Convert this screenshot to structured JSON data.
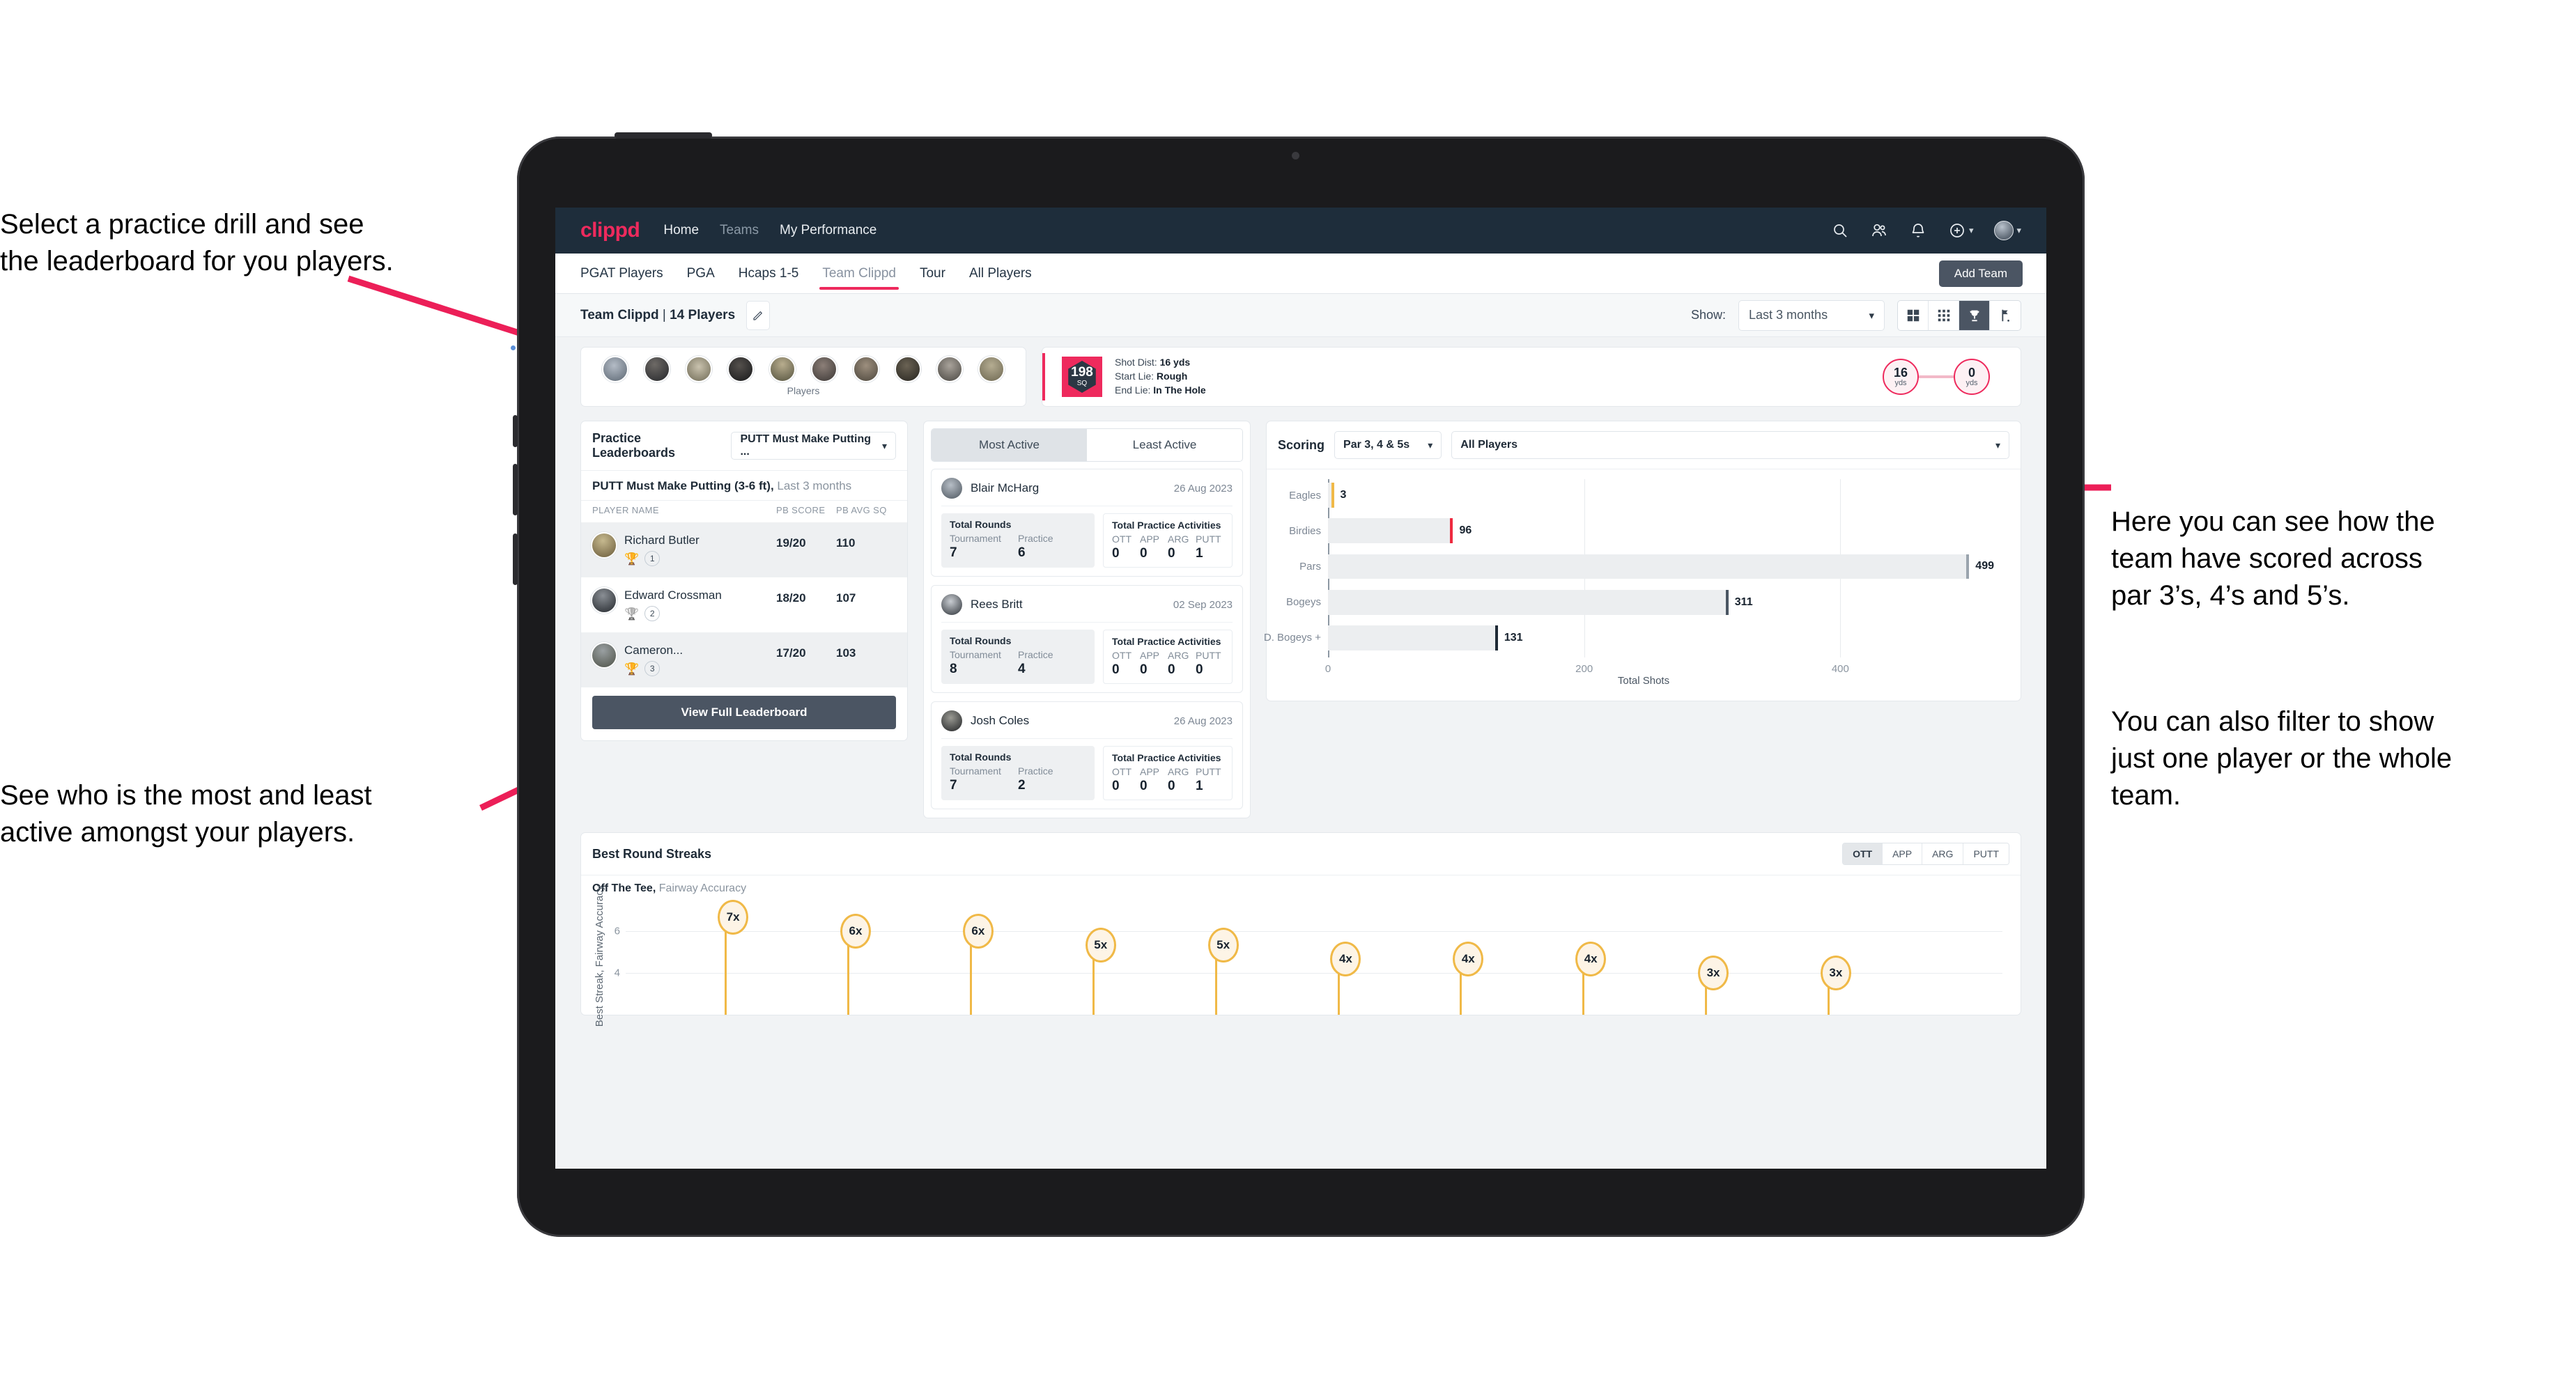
{
  "annotations": [
    {
      "id": "a1",
      "text": "Select a practice drill and see\nthe leaderboard for you players."
    },
    {
      "id": "a2",
      "text": "See who is the most and least\nactive amongst your players."
    },
    {
      "id": "a3",
      "text": "Here you can see how the\nteam have scored across\npar 3’s, 4’s and 5’s."
    },
    {
      "id": "a4",
      "text": "You can also filter to show\njust one player or the whole\nteam."
    }
  ],
  "topnav": {
    "logo": "clippd",
    "links": [
      {
        "label": "Home",
        "active": true
      },
      {
        "label": "Teams",
        "active": false
      },
      {
        "label": "My Performance",
        "active": true
      }
    ],
    "icons": [
      "search-icon",
      "people-icon",
      "bell-icon",
      "plus-circle-icon",
      "avatar"
    ]
  },
  "tabs": [
    {
      "label": "PGAT Players",
      "active": false
    },
    {
      "label": "PGA",
      "active": false
    },
    {
      "label": "Hcaps 1-5",
      "active": false
    },
    {
      "label": "Team Clippd",
      "active": true
    },
    {
      "label": "Tour",
      "active": false
    },
    {
      "label": "All Players",
      "active": false
    }
  ],
  "add_team_button": "Add Team",
  "subheader": {
    "team_name": "Team Clippd",
    "separator": " | ",
    "player_count": "14 Players",
    "edit_icon": "pencil-icon",
    "show_label": "Show:",
    "period_value": "Last 3 months",
    "view_buttons": [
      "grid-large-icon",
      "grid-small-icon",
      "trophy-icon",
      "flag-icon"
    ],
    "view_selected_index": 2
  },
  "players_strip": {
    "caption": "Players",
    "avatar_count": 10
  },
  "shot_card": {
    "sq_value": "198",
    "sq_label": "SQ",
    "lines": [
      {
        "key": "Shot Dist:",
        "value": "16 yds"
      },
      {
        "key": "Start Lie:",
        "value": "Rough"
      },
      {
        "key": "End Lie:",
        "value": "In The Hole"
      }
    ],
    "start_dist": {
      "value": "16",
      "unit": "yds"
    },
    "end_dist": {
      "value": "0",
      "unit": "yds"
    }
  },
  "leaderboard": {
    "title": "Practice Leaderboards",
    "drill_selected": "PUTT Must Make Putting ...",
    "subtitle_bold": "PUTT Must Make Putting (3-6 ft),",
    "subtitle_light": " Last 3 months",
    "columns": [
      "PLAYER NAME",
      "PB SCORE",
      "PB AVG SQ"
    ],
    "rows": [
      {
        "name": "Richard Butler",
        "rank": "1",
        "trophy": "gold",
        "score": "19/20",
        "avg_sq": "110"
      },
      {
        "name": "Edward Crossman",
        "rank": "2",
        "trophy": "silver",
        "score": "18/20",
        "avg_sq": "107"
      },
      {
        "name": "Cameron...",
        "rank": "3",
        "trophy": "bronze",
        "score": "17/20",
        "avg_sq": "103"
      }
    ],
    "button": "View Full Leaderboard"
  },
  "activity": {
    "tabs": [
      {
        "label": "Most Active",
        "selected": true
      },
      {
        "label": "Least Active",
        "selected": false
      }
    ],
    "rounds_title": "Total Rounds",
    "rounds_keys": [
      "Tournament",
      "Practice"
    ],
    "practice_title": "Total Practice Activities",
    "practice_keys": [
      "OTT",
      "APP",
      "ARG",
      "PUTT"
    ],
    "players": [
      {
        "name": "Blair McHarg",
        "date": "26 Aug 2023",
        "rounds": [
          "7",
          "6"
        ],
        "practice": [
          "0",
          "0",
          "0",
          "1"
        ]
      },
      {
        "name": "Rees Britt",
        "date": "02 Sep 2023",
        "rounds": [
          "8",
          "4"
        ],
        "practice": [
          "0",
          "0",
          "0",
          "0"
        ]
      },
      {
        "name": "Josh Coles",
        "date": "26 Aug 2023",
        "rounds": [
          "7",
          "2"
        ],
        "practice": [
          "0",
          "0",
          "0",
          "1"
        ]
      }
    ]
  },
  "scoring": {
    "title": "Scoring",
    "par_filter": "Par 3, 4 & 5s",
    "player_filter": "All Players"
  },
  "chart_data": [
    {
      "type": "bar",
      "orientation": "horizontal",
      "title": "Scoring",
      "categories": [
        "Eagles",
        "Birdies",
        "Pars",
        "Bogeys",
        "D. Bogeys +"
      ],
      "values": [
        3,
        96,
        499,
        311,
        131
      ],
      "cap_colors": [
        "#f0b947",
        "#ee2a3f",
        "#9aa4ad",
        "#4a5663",
        "#1f2a36"
      ],
      "xlabel": "Total Shots",
      "ylabel": "",
      "xticks": [
        0,
        200,
        400
      ],
      "xlim": [
        0,
        520
      ],
      "grid": true,
      "legend": "none"
    },
    {
      "type": "lollipop",
      "title": "Best Round Streaks",
      "subtitle_bold": "Off The Tee,",
      "subtitle_light": " Fairway Accuracy",
      "ylabel": "Best Streak, Fairway Accuracy",
      "yticks": [
        4,
        6
      ],
      "ylim": [
        0,
        8
      ],
      "values": [
        7,
        6,
        6,
        5,
        5,
        4,
        4,
        4,
        3,
        3
      ],
      "labels": [
        "7x",
        "6x",
        "6x",
        "5x",
        "5x",
        "4x",
        "4x",
        "4x",
        "3x",
        "3x"
      ],
      "metric_tabs": [
        {
          "label": "OTT",
          "selected": true
        },
        {
          "label": "APP",
          "selected": false
        },
        {
          "label": "ARG",
          "selected": false
        },
        {
          "label": "PUTT",
          "selected": false
        }
      ]
    }
  ]
}
